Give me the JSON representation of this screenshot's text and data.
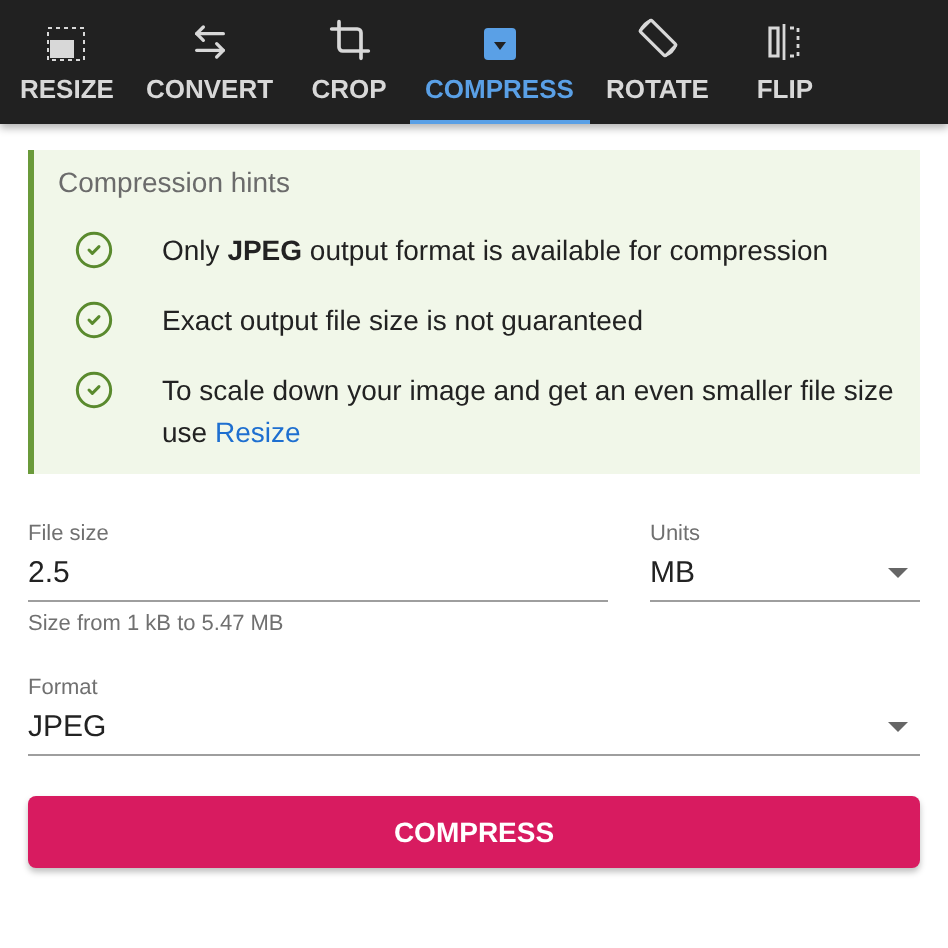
{
  "tabs": [
    {
      "kind": "resize",
      "label": "RESIZE",
      "selected": false
    },
    {
      "kind": "convert",
      "label": "CONVERT",
      "selected": false
    },
    {
      "kind": "crop",
      "label": "CROP",
      "selected": false
    },
    {
      "kind": "compress",
      "label": "COMPRESS",
      "selected": true
    },
    {
      "kind": "rotate",
      "label": "ROTATE",
      "selected": false
    },
    {
      "kind": "flip",
      "label": "FLIP",
      "selected": false
    }
  ],
  "hints": {
    "title": "Compression hints",
    "items": [
      {
        "text": "Only **JPEG** output format is available for compression"
      },
      {
        "text": "Exact output file size is not guaranteed"
      },
      {
        "text": "To scale down your image and get an even smaller file size use",
        "link": "Resize"
      }
    ]
  },
  "file_size": {
    "label": "File size",
    "value": "2.5",
    "helper": "Size from 1 kB to 5.47 MB"
  },
  "units": {
    "label": "Units",
    "value": "MB"
  },
  "format": {
    "label": "Format",
    "value": "JPEG"
  },
  "button": "COMPRESS"
}
